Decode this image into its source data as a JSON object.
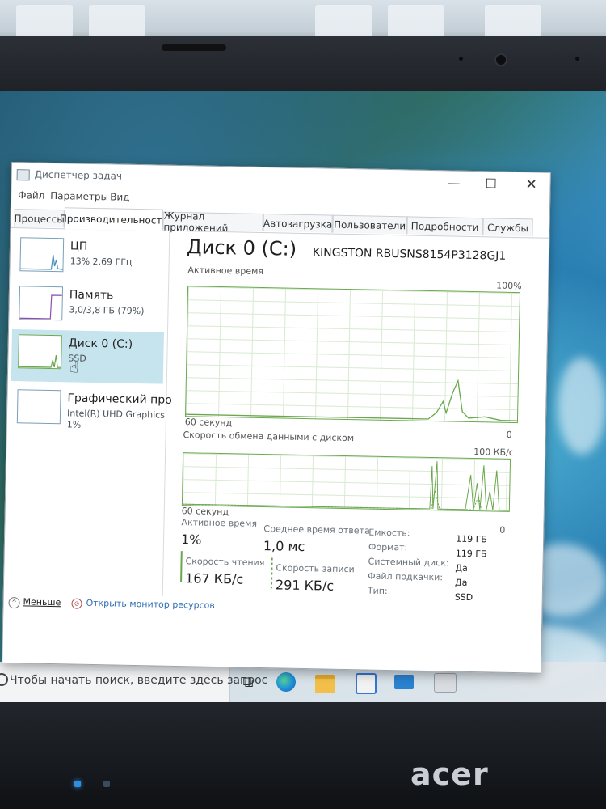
{
  "window": {
    "title": "Диспетчер задач",
    "menu": [
      "Файл",
      "Параметры",
      "Вид"
    ],
    "tabs": [
      "Процессы",
      "Производительность",
      "Журнал приложений",
      "Автозагрузка",
      "Пользователи",
      "Подробности",
      "Службы"
    ],
    "active_tab": "Производительность"
  },
  "sidebar": {
    "items": [
      {
        "name": "ЦП",
        "sub": "13% 2,69 ГГц"
      },
      {
        "name": "Память",
        "sub": "3,0/3,8 ГБ (79%)"
      },
      {
        "name": "Диск 0 (C:)",
        "sub": "SSD"
      },
      {
        "name": "Графический про",
        "sub": "Intel(R) UHD Graphics",
        "sub2": "1%"
      }
    ],
    "active_index": 2
  },
  "main": {
    "title": "Диск 0 (C:)",
    "model": "KINGSTON RBUSNS8154P3128GJ1",
    "graph1": {
      "label": "Активное время",
      "max": "100%",
      "time": "60 секунд",
      "min": "0"
    },
    "graph2": {
      "label": "Скорость обмена данными с диском",
      "max": "100 КБ/с",
      "time": "60 секунд",
      "min": "0"
    },
    "stats": {
      "active_time_label": "Активное время",
      "active_time_value": "1%",
      "response_label": "Среднее время ответа",
      "response_value": "1,0 мс",
      "read_label": "Скорость чтения",
      "read_value": "167 КБ/с",
      "write_label": "Скорость записи",
      "write_value": "291 КБ/с"
    },
    "properties": [
      {
        "label": "Емкость:",
        "value": "119 ГБ"
      },
      {
        "label": "Формат:",
        "value": "119 ГБ"
      },
      {
        "label": "Системный диск:",
        "value": "Да"
      },
      {
        "label": "Файл подкачки:",
        "value": "Да"
      },
      {
        "label": "Тип:",
        "value": "SSD"
      }
    ]
  },
  "footer": {
    "less_label": "Меньше",
    "monitor_label": "Открыть монитор ресурсов"
  },
  "taskbar": {
    "search_placeholder": "Чтобы начать поиск, введите здесь запрос"
  },
  "laptop": {
    "brand": "acer"
  },
  "colors": {
    "graph_line": "#6aa84f",
    "selected_item": "#c6e4ee",
    "cpu_graph": "#4a8fc0"
  }
}
